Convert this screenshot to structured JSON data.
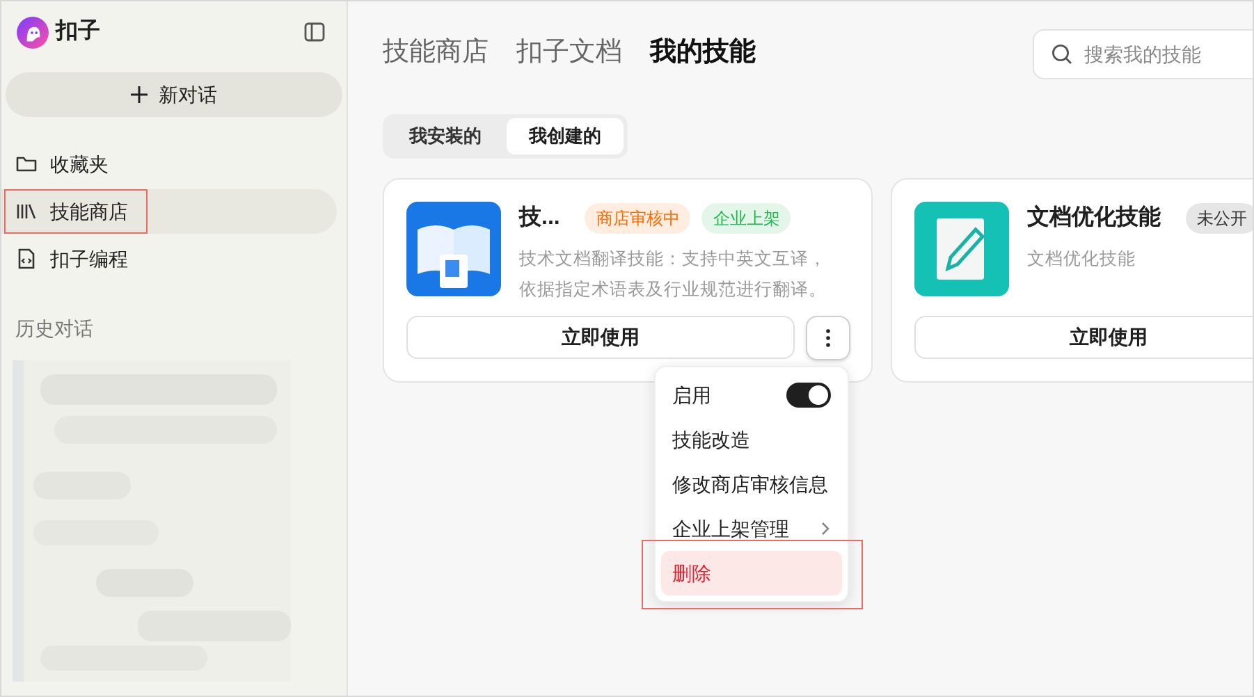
{
  "app": {
    "name": "扣子"
  },
  "new_chat": {
    "label": "新对话"
  },
  "sidebar": {
    "items": [
      {
        "label": "收藏夹",
        "selected": false,
        "highlighted": false
      },
      {
        "label": "技能商店",
        "selected": true,
        "highlighted": true
      },
      {
        "label": "扣子编程",
        "selected": false,
        "highlighted": false
      }
    ],
    "history_title": "历史对话"
  },
  "header_tabs": [
    {
      "label": "技能商店",
      "selected": false
    },
    {
      "label": "扣子文档",
      "selected": false
    },
    {
      "label": "我的技能",
      "selected": true
    }
  ],
  "search": {
    "placeholder": "搜索我的技能"
  },
  "segments": [
    {
      "label": "我安装的",
      "selected": false
    },
    {
      "label": "我创建的",
      "selected": true
    }
  ],
  "cards": [
    {
      "title": "技...",
      "badges": [
        {
          "label": "商店审核中",
          "color": "#ff6a00"
        },
        {
          "label": "企业上架",
          "color": "#1fb94e"
        }
      ],
      "description": "技术文档翻译技能：支持中英文互译，依据指定术语表及行业规范进行翻译。",
      "button": "立即使用"
    },
    {
      "title": "文档优化技能",
      "badges": [
        {
          "label": "未公开",
          "color": "#333333"
        }
      ],
      "description": "文档优化技能",
      "button": "立即使用"
    }
  ],
  "menu": {
    "items": [
      {
        "label": "启用",
        "kind": "toggle",
        "on": true,
        "highlighted": false
      },
      {
        "label": "技能改造",
        "kind": "plain",
        "highlighted": false
      },
      {
        "label": "修改商店审核信息",
        "kind": "plain",
        "highlighted": false
      },
      {
        "label": "企业上架管理",
        "kind": "submenu",
        "highlighted": false
      },
      {
        "label": "删除",
        "kind": "danger",
        "highlighted": true
      }
    ]
  }
}
